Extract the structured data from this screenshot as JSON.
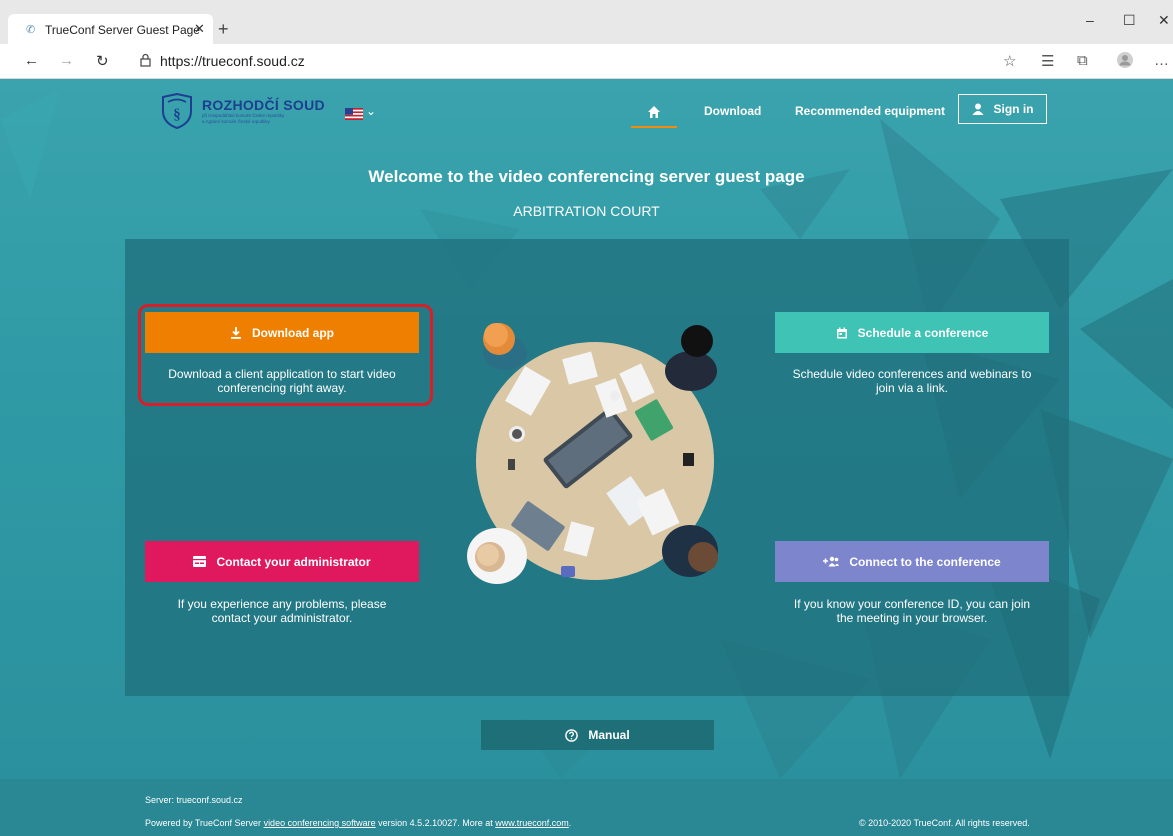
{
  "browser": {
    "tab_title": "TrueConf Server Guest Page",
    "url": "https://trueconf.soud.cz"
  },
  "header": {
    "logo_title": "ROZHODČÍ SOUD",
    "logo_sub1": "při Hospodářské komoře České republiky",
    "logo_sub2": "a Agrární komoře České republiky",
    "nav": {
      "download": "Download",
      "recommended": "Recommended equipment",
      "signin": "Sign in"
    }
  },
  "main": {
    "welcome": "Welcome to the video conferencing server guest page",
    "court": "ARBITRATION COURT",
    "actions": {
      "download_label": "Download app",
      "download_desc": "Download a client application to start video conferencing right away.",
      "schedule_label": "Schedule a conference",
      "schedule_desc": "Schedule video conferences and webinars to join via a link.",
      "contact_label": "Contact your administrator",
      "contact_desc": "If you experience any problems, please contact your administrator.",
      "connect_label": "Connect to the conference",
      "connect_desc": "If you know your conference ID, you can join the meeting in your browser."
    },
    "manual": "Manual"
  },
  "footer": {
    "server": "Server: trueconf.soud.cz",
    "powered_prefix": "Powered by TrueConf Server ",
    "powered_link": "video conferencing software",
    "powered_mid": " version 4.5.2.10027. More at ",
    "powered_site": "www.trueconf.com",
    "powered_suffix": ".",
    "copyright": "© 2010-2020 TrueConf. All rights reserved."
  },
  "colors": {
    "download": "#ef7f00",
    "schedule": "#3ec3b5",
    "contact": "#e0195f",
    "connect": "#7d85cc",
    "highlight": "#d61f26"
  }
}
